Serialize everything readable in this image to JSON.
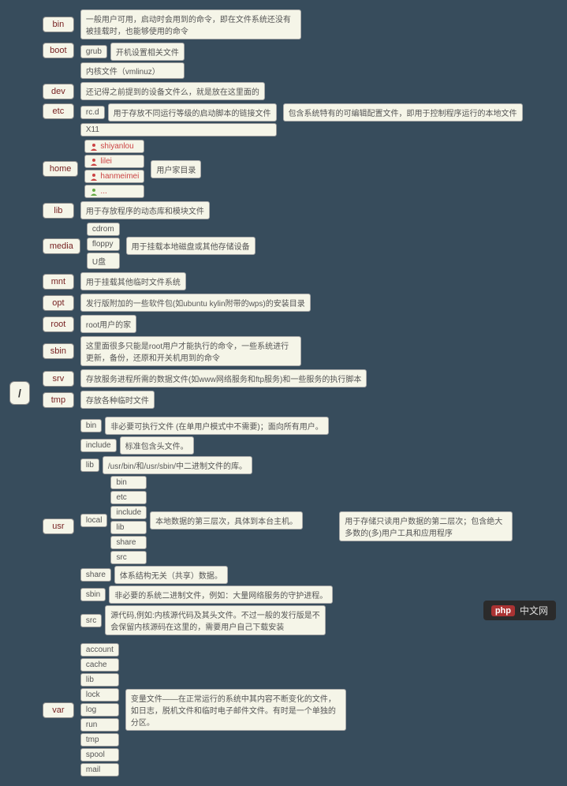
{
  "root": "/",
  "watermark": {
    "logo": "php",
    "text": "中文网"
  },
  "dirs": {
    "bin": {
      "label": "bin",
      "desc": "一般用户可用，启动时会用到的命令，即在文件系统还没有被挂载时，也能够使用的命令"
    },
    "boot": {
      "label": "boot",
      "sub1": "grub",
      "sub1desc": "开机设置相关文件",
      "sub2": "内核文件（vmlinuz）"
    },
    "dev": {
      "label": "dev",
      "desc": "还记得之前提到的设备文件么，就是放在这里面的"
    },
    "etc": {
      "label": "etc",
      "sub1": "rc.d",
      "sub1desc": "用于存放不同运行等级的启动脚本的链接文件",
      "sub2": "X11",
      "desc": "包含系统特有的可编辑配置文件，即用于控制程序运行的本地文件"
    },
    "home": {
      "label": "home",
      "u1": "shiyanlou",
      "u2": "lilei",
      "u3": "hanmeimei",
      "u4": "...",
      "desc": "用户家目录"
    },
    "lib": {
      "label": "lib",
      "desc": "用于存放程序的动态库和模块文件"
    },
    "media": {
      "label": "media",
      "s1": "cdrom",
      "s2": "floppy",
      "s3": "U盘",
      "desc": "用于挂载本地磁盘或其他存储设备"
    },
    "mnt": {
      "label": "mnt",
      "desc": "用于挂载其他临时文件系统"
    },
    "opt": {
      "label": "opt",
      "desc": "发行版附加的一些软件包(如ubuntu kylin附带的wps)的安装目录"
    },
    "root": {
      "label": "root",
      "desc": "root用户的家"
    },
    "sbin": {
      "label": "sbin",
      "desc": "这里面很多只能是root用户才能执行的命令，一些系统进行更新，备份，还原和开关机用到的命令"
    },
    "srv": {
      "label": "srv",
      "desc": "存放服务进程所需的数据文件(如www网络服务和ftp服务)和一些服务的执行脚本"
    },
    "tmp": {
      "label": "tmp",
      "desc": "存放各种临时文件"
    },
    "usr": {
      "label": "usr",
      "bin": {
        "label": "bin",
        "desc": "非必要可执行文件 (在单用户模式中不需要)；面向所有用户。"
      },
      "include": {
        "label": "include",
        "desc": "标准包含头文件。"
      },
      "lib": {
        "label": "lib",
        "desc": "/usr/bin/和/usr/sbin/中二进制文件的库。"
      },
      "local": {
        "label": "local",
        "subs": [
          "bin",
          "etc",
          "include",
          "lib",
          "share",
          "src"
        ],
        "desc": "本地数据的第三层次，具体到本台主机。"
      },
      "share": {
        "label": "share",
        "desc": "体系结构无关（共享）数据。"
      },
      "sbin": {
        "label": "sbin",
        "desc": "非必要的系统二进制文件，例如：大量网络服务的守护进程。"
      },
      "src": {
        "label": "src",
        "desc": "源代码,例如:内核源代码及其头文件。不过一般的发行版是不会保留内核源码在这里的，需要用户自己下载安装"
      },
      "desc": "用于存储只读用户数据的第二层次；包含绝大多数的(多)用户工具和应用程序"
    },
    "var": {
      "label": "var",
      "subs": [
        "account",
        "cache",
        "lib",
        "lock",
        "log",
        "run",
        "tmp",
        "spool",
        "mail"
      ],
      "desc": "变量文件——在正常运行的系统中其内容不断变化的文件，如日志，脱机文件和临时电子邮件文件。有时是一个单独的分区。"
    }
  }
}
